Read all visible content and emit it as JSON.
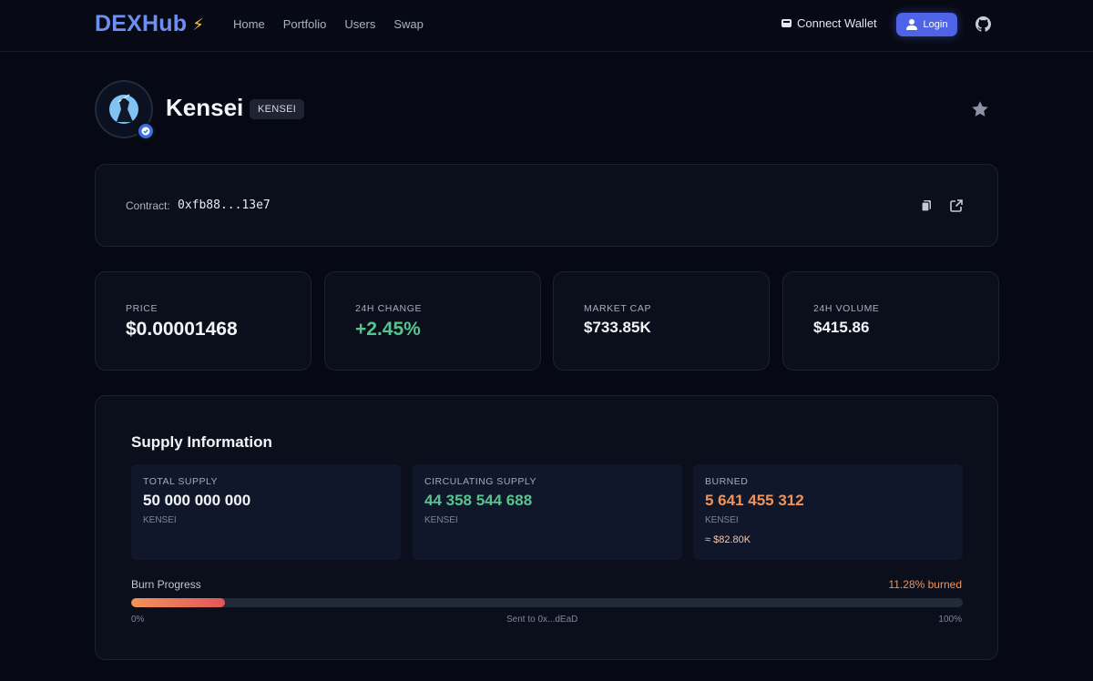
{
  "header": {
    "brand": "DEXHub",
    "nav": [
      "Home",
      "Portfolio",
      "Users",
      "Swap"
    ],
    "connect_wallet": "Connect Wallet",
    "login": "Login"
  },
  "token": {
    "name": "Kensei",
    "symbol": "KENSEI"
  },
  "contract": {
    "label": "Contract:",
    "address": "0xfb88...13e7"
  },
  "stats": [
    {
      "label": "PRICE",
      "value": "$0.00001468"
    },
    {
      "label": "24H CHANGE",
      "value": "+2.45%"
    },
    {
      "label": "MARKET CAP",
      "value": "$733.85K"
    },
    {
      "label": "24H VOLUME",
      "value": "$415.86"
    }
  ],
  "supply": {
    "title": "Supply Information",
    "total": {
      "label": "TOTAL SUPPLY",
      "value": "50 000 000 000",
      "unit": "KENSEI"
    },
    "circulating": {
      "label": "CIRCULATING SUPPLY",
      "value": "44 358 544 688",
      "unit": "KENSEI"
    },
    "burned": {
      "label": "BURNED",
      "value": "5 641 455 312",
      "unit": "KENSEI",
      "usd": "≈ $82.80K"
    },
    "burn_progress_label": "Burn Progress",
    "burn_pct_text": "11.28% burned",
    "burn_fraction": 0.1128,
    "min_label": "0%",
    "mid_label": "Sent to 0x...dEaD",
    "max_label": "100%"
  },
  "colors": {
    "accent": "#4e63e6",
    "brand": "#6d8ff2",
    "positive": "#55c58c",
    "burn": "#f0935a"
  }
}
